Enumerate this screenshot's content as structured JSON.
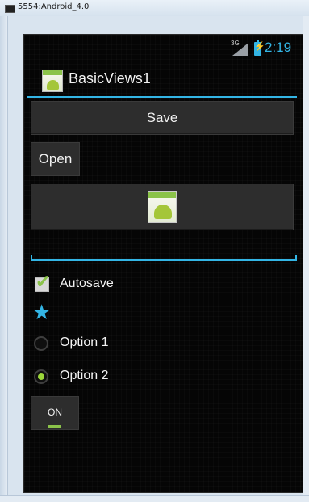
{
  "window": {
    "title": "5554:Android_4.0"
  },
  "status_bar": {
    "network": "3G",
    "time": "2:19",
    "accent_color": "#33b5e5"
  },
  "action_bar": {
    "title": "BasicViews1",
    "icon": "android-app-icon"
  },
  "buttons": {
    "save_label": "Save",
    "open_label": "Open",
    "image_button_icon": "android-app-icon"
  },
  "edit_text": {
    "value": ""
  },
  "checkbox": {
    "label": "Autosave",
    "checked": true
  },
  "star": {
    "icon": "star-icon",
    "color": "#33b5e5"
  },
  "radios": [
    {
      "label": "Option 1",
      "checked": false
    },
    {
      "label": "Option 2",
      "checked": true
    }
  ],
  "toggle": {
    "label": "ON",
    "state": true,
    "indicator_color": "#8bc34a"
  }
}
